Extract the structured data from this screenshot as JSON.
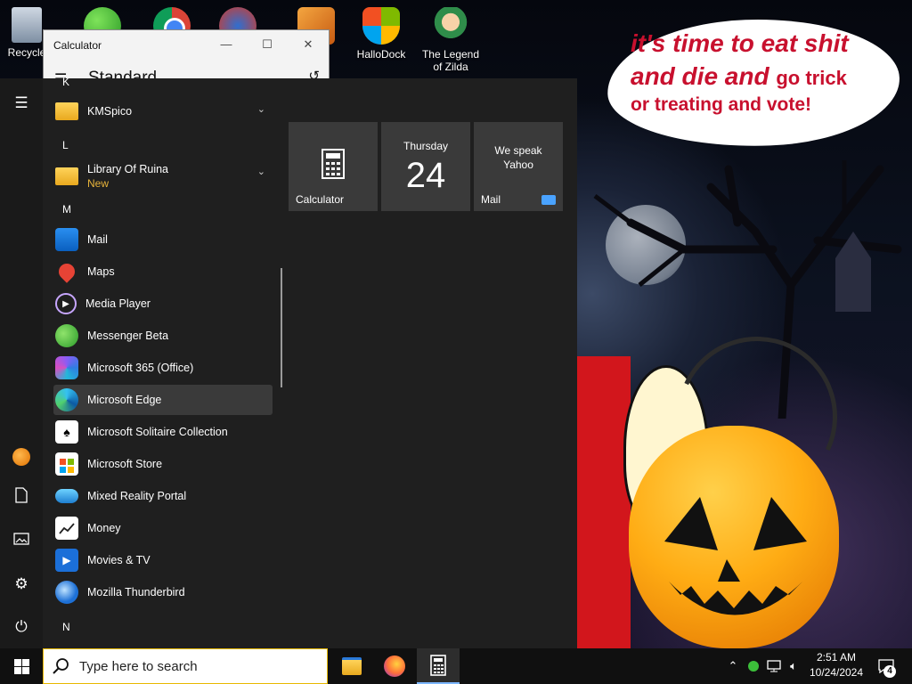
{
  "wallpaper": {
    "caption_line1": "it's time to eat shit",
    "caption_line2a": "and die and",
    "caption_line2b": "go trick",
    "caption_line3": "or treating and vote!"
  },
  "desktop": {
    "icons": [
      {
        "label": "Recycle",
        "icon": "recycle-bin-icon"
      },
      {
        "label": "",
        "icon": "messenger-people-icon"
      },
      {
        "label": "",
        "icon": "chrome-icon"
      },
      {
        "label": "",
        "icon": "app-shortcut-icon"
      },
      {
        "label": "",
        "icon": "app-shortcut-icon"
      },
      {
        "label": "HalloDock",
        "icon": "windows-logo-icon"
      },
      {
        "label": "The Legend of Zilda",
        "icon": "game-character-icon"
      }
    ]
  },
  "calculator_window": {
    "title": "Calculator",
    "mode": "Standard",
    "controls": {
      "minimize": "—",
      "maximize": "☐",
      "close": "✕"
    }
  },
  "start_menu": {
    "rail": [
      "hamburger-icon",
      "user-avatar-icon",
      "documents-icon",
      "pictures-icon",
      "settings-icon",
      "power-icon"
    ],
    "letters": {
      "k": "K",
      "l": "L",
      "m": "M",
      "n": "N"
    },
    "apps": {
      "kmspico": "KMSpico",
      "library": "Library Of Ruina",
      "library_badge": "New",
      "mail": "Mail",
      "maps": "Maps",
      "media_player": "Media Player",
      "messenger": "Messenger Beta",
      "m365": "Microsoft 365 (Office)",
      "edge": "Microsoft Edge",
      "solitaire": "Microsoft Solitaire Collection",
      "store": "Microsoft Store",
      "mixed_reality": "Mixed Reality Portal",
      "money": "Money",
      "movies": "Movies & TV",
      "thunderbird": "Mozilla Thunderbird"
    },
    "tiles": {
      "calculator": "Calculator",
      "calendar_day": "Thursday",
      "calendar_date": "24",
      "mail_preview_line1": "We speak",
      "mail_preview_line2": "Yahoo",
      "mail": "Mail"
    }
  },
  "taskbar": {
    "search_placeholder": "Type here to search",
    "pinned": [
      "file-explorer-icon",
      "firefox-icon",
      "calculator-icon"
    ],
    "clock_time": "2:51 AM",
    "clock_date": "10/24/2024",
    "notification_count": "4"
  },
  "colors": {
    "accent": "#0078d4",
    "start_bg": "#1f1f1f",
    "tile_bg": "#3a3a3a",
    "caption_red": "#c8102e",
    "badge_new": "#e8b43a"
  }
}
